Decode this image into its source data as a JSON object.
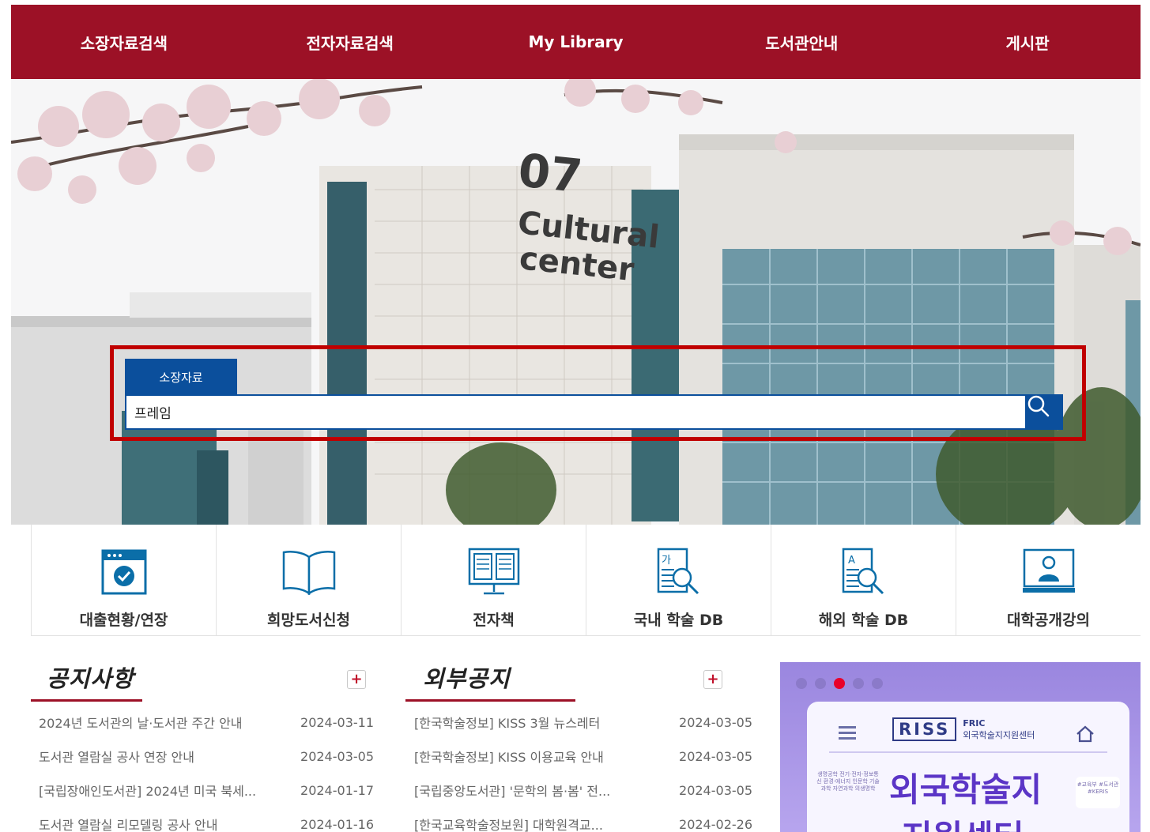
{
  "nav": {
    "items": [
      "소장자료검색",
      "전자자료검색",
      "My Library",
      "도서관안내",
      "게시판"
    ]
  },
  "hero": {
    "building_number": "07",
    "building_name_1": "Cultural",
    "building_name_2": "center"
  },
  "search": {
    "tab_label": "소장자료",
    "query": "프레임",
    "button_icon": "search-icon"
  },
  "quick_links": [
    {
      "label": "대출현황/연장",
      "icon": "calendar-check-icon"
    },
    {
      "label": "희망도서신청",
      "icon": "open-book-icon"
    },
    {
      "label": "전자책",
      "icon": "ebook-monitor-icon"
    },
    {
      "label": "국내 학술 DB",
      "icon": "korean-db-search-icon"
    },
    {
      "label": "해외 학술 DB",
      "icon": "foreign-db-search-icon"
    },
    {
      "label": "대학공개강의",
      "icon": "lecture-monitor-icon"
    }
  ],
  "notices": {
    "title": "공지사항",
    "more_icon": "plus-icon",
    "items": [
      {
        "title": "2024년 도서관의 날·도서관 주간 안내",
        "date": "2024-03-11"
      },
      {
        "title": "도서관 열람실 공사 연장 안내",
        "date": "2024-03-05"
      },
      {
        "title": "[국립장애인도서관] 2024년 미국 북세...",
        "date": "2024-01-17"
      },
      {
        "title": "도서관 열람실 리모델링 공사 안내",
        "date": "2024-01-16"
      }
    ]
  },
  "external": {
    "title": "외부공지",
    "more_icon": "plus-icon",
    "items": [
      {
        "title": "[한국학술정보] KISS 3월 뉴스레터",
        "date": "2024-03-05"
      },
      {
        "title": "[한국학술정보] KISS 이용교육 안내",
        "date": "2024-03-05"
      },
      {
        "title": "[국립중앙도서관] '문학의 봄·봄' 전...",
        "date": "2024-03-05"
      },
      {
        "title": "[한국교육학술정보원] 대학원격교...",
        "date": "2024-02-26"
      }
    ]
  },
  "banner": {
    "active_dot": 2,
    "dot_count": 5,
    "logo_text": "RISS",
    "logo_sub_1": "FRIC",
    "logo_sub_2": "외국학술지지원센터",
    "headline_1": "외국학술지",
    "headline_2": "지원센터",
    "tag_left": "생명공학 전기·전자·정보통신 환경·에너지 인문학 기술과학 자연과학 의생명학",
    "tag_right": "#교육부 #도서관 #KERIS"
  },
  "colors": {
    "brand": "#9c1126",
    "search_blue": "#0b4f9c",
    "highlight": "#c00000"
  }
}
